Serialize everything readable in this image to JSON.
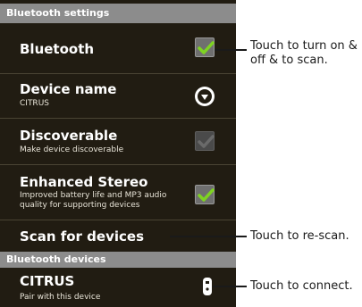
{
  "bluetooth_settings_header": "Bluetooth settings",
  "settings": [
    {
      "title": "Bluetooth",
      "subtitle": "",
      "checked": true
    },
    {
      "title": "Device name",
      "subtitle": "CITRUS",
      "control": "chevron-down-icon"
    },
    {
      "title": "Discoverable",
      "subtitle": "Make device discoverable",
      "checked": false
    },
    {
      "title": "Enhanced Stereo",
      "subtitle": "Improved battery life and MP3 audio quality for supporting devices",
      "checked": true
    },
    {
      "title": "Scan for devices",
      "subtitle": ""
    }
  ],
  "bluetooth_devices_header": "Bluetooth devices",
  "device": {
    "name": "CITRUS",
    "status": "Pair with this device",
    "icon": "phone-device-icon"
  },
  "callouts": {
    "toggle": "Touch  to turn on & off & to scan.",
    "rescan": "Touch to re-scan.",
    "connect": "Touch to connect."
  },
  "colors": {
    "check_green": "#7ed321",
    "header_bg": "#8c8c8c",
    "panel_bg": "#211c12"
  }
}
